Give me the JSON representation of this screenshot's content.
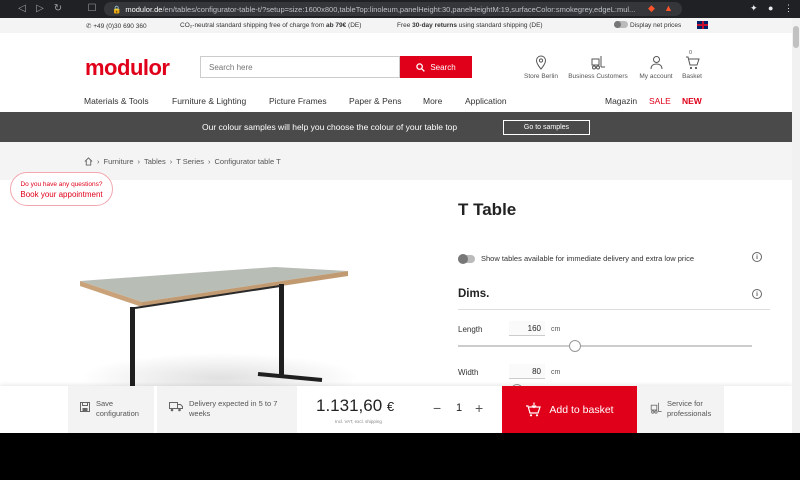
{
  "browser": {
    "url_host": "modulor.de",
    "url_path": "/en/tables/configurator-table-t/?setup=size:1600x800,tableTop:linoleum,panelHeight:30,panelHeightM:19,surfaceColor:smokegrey,edgeL:mul..."
  },
  "topbar": {
    "phone": "+49 (0)30 690 360",
    "shipping_prefix": "CO₂-neutral standard shipping free of charge from ",
    "shipping_bold": "ab 79€",
    "shipping_suffix": " (DE)",
    "returns_prefix": "Free ",
    "returns_bold": "30-day returns",
    "returns_suffix": " using standard shipping (DE)",
    "net_prices": "Display net prices"
  },
  "header": {
    "logo": "modulor",
    "search_placeholder": "Search here",
    "search_button": "Search",
    "icons": [
      {
        "label": "Store Berlin"
      },
      {
        "label": "Business Customers"
      },
      {
        "label": "My account"
      },
      {
        "label": "Basket",
        "count": "0"
      }
    ]
  },
  "nav": {
    "items": [
      "Materials & Tools",
      "Furniture & Lighting",
      "Picture Frames",
      "Paper & Pens",
      "More",
      "Application"
    ],
    "magazin": "Magazin",
    "sale": "SALE",
    "new": "NEW"
  },
  "banner": {
    "text": "Our colour samples will help you choose the colour of your table top",
    "button": "Go to samples"
  },
  "breadcrumb": [
    "Furniture",
    "Tables",
    "T Series",
    "Configurator table T"
  ],
  "appointment": {
    "line1": "Do you have any questions?",
    "line2": "Book your appointment"
  },
  "product": {
    "title": "T Table",
    "toggle_label": "Show tables available for immediate delivery and extra low price",
    "dims_heading": "Dims.",
    "length_label": "Length",
    "length_value": "160",
    "width_label": "Width",
    "width_value": "80",
    "unit": "cm"
  },
  "footer": {
    "save_line1": "Save",
    "save_line2": "configuration",
    "delivery_line1": "Delivery expected in 5 to 7",
    "delivery_line2": "weeks",
    "price": "1.131,60",
    "currency": "€",
    "price_note": "Incl. VAT, excl. shipping",
    "quantity": "1",
    "add_to_basket": "Add to basket",
    "service_line1": "Service for",
    "service_line2": "professionals"
  },
  "colors": {
    "brand_red": "#e0001a",
    "banner_bg": "#4a4a4a",
    "table_top": "#b8bdb6",
    "table_edge": "#c9a27a",
    "table_frame": "#1f1f1f"
  }
}
